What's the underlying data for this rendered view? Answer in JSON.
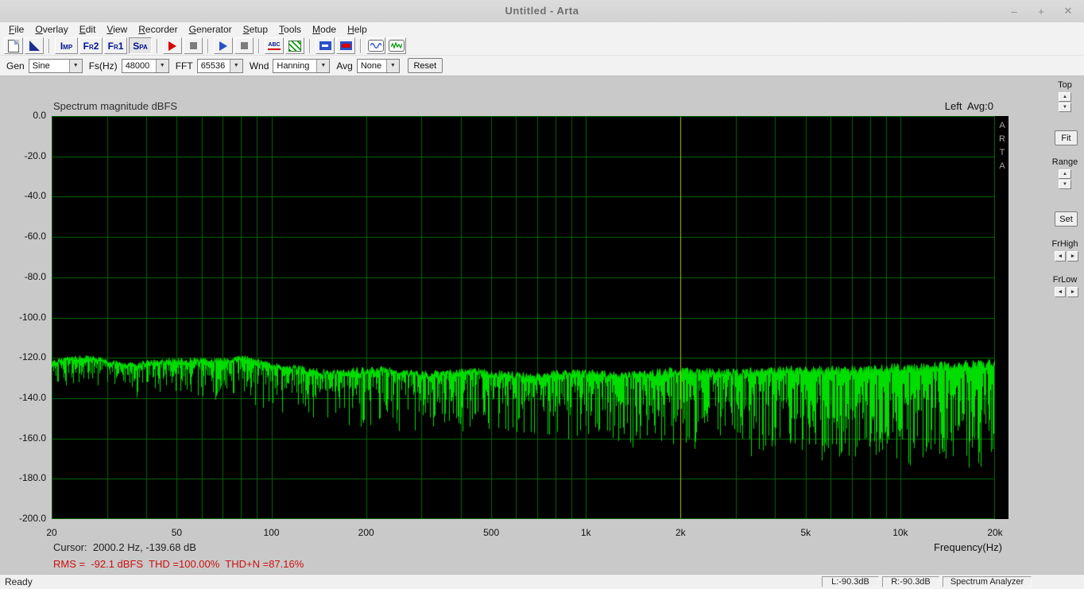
{
  "window": {
    "title": "Untitled - Arta",
    "minimize": "–",
    "maximize": "+",
    "close": "✕"
  },
  "menu": {
    "items": [
      "File",
      "Overlay",
      "Edit",
      "View",
      "Recorder",
      "Generator",
      "Setup",
      "Tools",
      "Mode",
      "Help"
    ]
  },
  "toolbar": {
    "icons": [
      "new-file-icon",
      "overlay-corner-icon",
      "record-red-icon",
      "stop-icon",
      "play-blue-icon",
      "stop-icon",
      "abc-labels-icon",
      "green-hatch-icon",
      "mic-gain-icon",
      "level-bar-icon",
      "sine-wave-icon",
      "noise-wave-icon"
    ],
    "abc_label": "ABC",
    "mode_buttons": [
      {
        "label": "Imp",
        "active": false
      },
      {
        "label": "Fr2",
        "active": false
      },
      {
        "label": "Fr1",
        "active": false
      },
      {
        "label": "Spa",
        "active": true
      }
    ]
  },
  "controls": {
    "gen_label": "Gen",
    "gen_value": "Sine",
    "fs_label": "Fs(Hz)",
    "fs_value": "48000",
    "fft_label": "FFT",
    "fft_value": "65536",
    "wnd_label": "Wnd",
    "wnd_value": "Hanning",
    "avg_label": "Avg",
    "avg_value": "None",
    "reset_label": "Reset"
  },
  "plot": {
    "title": "Spectrum magnitude dBFS",
    "channel_info": "Left  Avg:0",
    "watermark": "ARTA",
    "xlabel": "Frequency(Hz)",
    "cursor_text": "Cursor:  2000.2 Hz, -139.68 dB",
    "stats_text": "RMS =  -92.1 dBFS  THD =100.00%  THD+N =87.16%"
  },
  "measurements": {
    "rms_dbfs": -92.1,
    "thd_percent": 100.0,
    "thd_n_percent": 87.16
  },
  "chart_data": {
    "type": "line",
    "title": "Spectrum magnitude dBFS",
    "xlabel": "Frequency(Hz)",
    "ylabel": "dBFS",
    "x_scale": "log",
    "xlim": [
      20,
      20000
    ],
    "ylim": [
      -200,
      0
    ],
    "grid": true,
    "xticks": {
      "values": [
        20,
        50,
        100,
        200,
        500,
        1000,
        2000,
        5000,
        10000,
        20000
      ],
      "labels": [
        "20",
        "50",
        "100",
        "200",
        "500",
        "1k",
        "2k",
        "5k",
        "10k",
        "20k"
      ]
    },
    "yticks": {
      "values": [
        0,
        -20,
        -40,
        -60,
        -80,
        -100,
        -120,
        -140,
        -160,
        -180,
        -200
      ],
      "labels": [
        "0.0",
        "-20.0",
        "-40.0",
        "-60.0",
        "-80.0",
        "-100.0",
        "-120.0",
        "-140.0",
        "-160.0",
        "-180.0",
        "-200.0"
      ]
    },
    "cursor": {
      "freq_hz": 2000.2,
      "level_db": -139.68
    },
    "noise_envelope": {
      "freq": [
        20,
        30,
        50,
        80,
        100,
        150,
        200,
        300,
        500,
        700,
        1000,
        1500,
        2000,
        3000,
        5000,
        7000,
        10000,
        15000,
        20000
      ],
      "upper_db": [
        -122,
        -121,
        -123,
        -119,
        -125,
        -126,
        -127,
        -127,
        -128,
        -128,
        -128,
        -128,
        -127,
        -127,
        -126,
        -126,
        -125,
        -124,
        -123
      ],
      "lower_db": [
        -136,
        -138,
        -140,
        -142,
        -148,
        -152,
        -156,
        -158,
        -158,
        -160,
        -162,
        -164,
        -166,
        -168,
        -170,
        -172,
        -173,
        -174,
        -176
      ]
    },
    "grid_color": "#006a00",
    "trace_color": "#00dd00",
    "cursor_color": "#b8b818",
    "seed": 7
  },
  "side_panel": {
    "top_label": "Top",
    "fit_label": "Fit",
    "range_label": "Range",
    "set_label": "Set",
    "frhigh_label": "FrHigh",
    "frlow_label": "FrLow",
    "arrows": {
      "up": "▲",
      "down": "▼",
      "left": "◄",
      "right": "►"
    }
  },
  "status_bar": {
    "ready": "Ready",
    "left_level": "L:-90.3dB",
    "right_level": "R:-90.3dB",
    "mode": "Spectrum Analyzer"
  }
}
